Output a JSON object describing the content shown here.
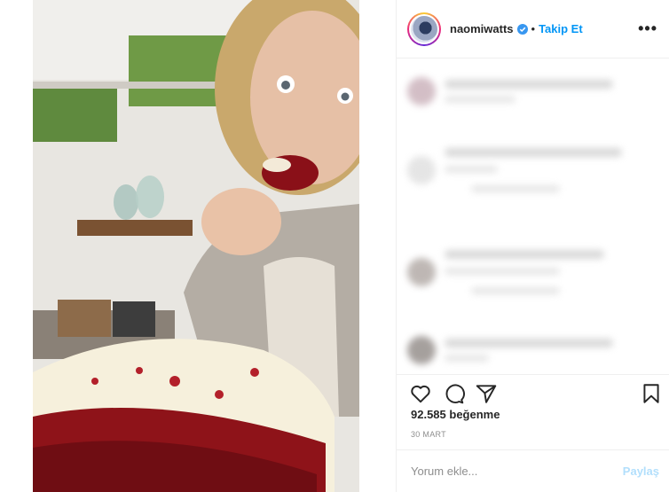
{
  "post": {
    "photo_description_icon": "photo-icon",
    "header": {
      "username": "naomiwatts",
      "separator": "•",
      "follow_label": "Takip Et",
      "more_label": "•••"
    },
    "likes_text": "92.585 beğenme",
    "date_text": "30 MART",
    "comment": {
      "placeholder": "Yorum ekle...",
      "post_label": "Paylaş"
    }
  },
  "colors": {
    "accent": "#0095f6",
    "disabled_accent": "#b2dffc",
    "text": "#262626",
    "muted": "#8e8e8e"
  },
  "icons": [
    "heart-icon",
    "comment-icon",
    "share-icon",
    "bookmark-icon",
    "verified-icon",
    "more-icon"
  ]
}
